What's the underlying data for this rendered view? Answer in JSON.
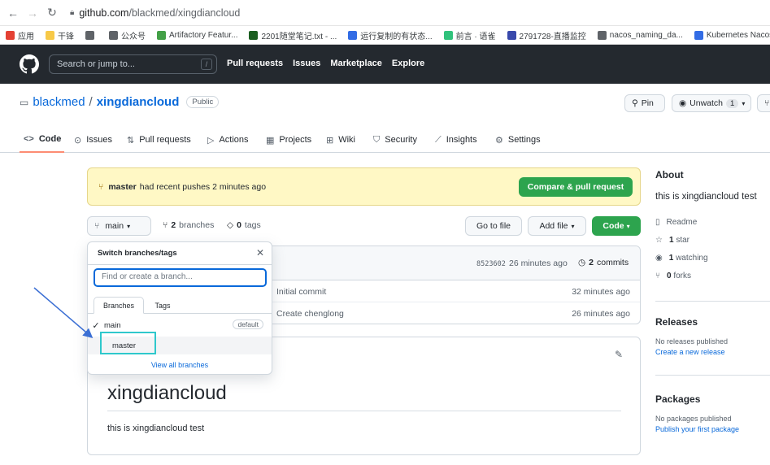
{
  "browser": {
    "url_host": "github.com",
    "url_path": "/blackmed/xingdiancloud",
    "bookmarks": [
      {
        "label": "应用",
        "color": "#e44134"
      },
      {
        "label": "干锋",
        "color": "#f7c948"
      },
      {
        "label": "",
        "color": "#5f6368"
      },
      {
        "label": "公众号",
        "color": "#5f6368"
      },
      {
        "label": "Artifactory Featur...",
        "color": "#43a047"
      },
      {
        "label": "2201随堂笔记.txt - ...",
        "color": "#1b5e20"
      },
      {
        "label": "运行复制的有状态...",
        "color": "#326ce5"
      },
      {
        "label": "前言 · 语雀",
        "color": "#31c27c"
      },
      {
        "label": "2791728-直播监控",
        "color": "#3949ab"
      },
      {
        "label": "nacos_naming_da...",
        "color": "#5f6368"
      },
      {
        "label": "Kubernetes Nacos",
        "color": "#326ce5"
      }
    ]
  },
  "header": {
    "search_placeholder": "Search or jump to...",
    "search_key": "/",
    "nav": [
      "Pull requests",
      "Issues",
      "Marketplace",
      "Explore"
    ]
  },
  "repo": {
    "owner": "blackmed",
    "separator": "/",
    "name": "xingdiancloud",
    "visibility": "Public",
    "pin_label": "Pin",
    "watch_label": "Unwatch",
    "watch_count": "1"
  },
  "tabs": [
    {
      "label": "Code",
      "icon": "<>"
    },
    {
      "label": "Issues",
      "icon": "⊙"
    },
    {
      "label": "Pull requests",
      "icon": "⇅"
    },
    {
      "label": "Actions",
      "icon": "▷"
    },
    {
      "label": "Projects",
      "icon": "▦"
    },
    {
      "label": "Wiki",
      "icon": "⊞"
    },
    {
      "label": "Security",
      "icon": "⛉"
    },
    {
      "label": "Insights",
      "icon": "⟋"
    },
    {
      "label": "Settings",
      "icon": "⚙"
    }
  ],
  "notice": {
    "branch": "master",
    "text": "had recent pushes 2 minutes ago",
    "button": "Compare & pull request"
  },
  "branch_bar": {
    "current": "main",
    "branches_count": "2",
    "branches_label": "branches",
    "tags_count": "0",
    "tags_label": "tags",
    "goto_file": "Go to file",
    "add_file": "Add file",
    "code": "Code"
  },
  "files": {
    "sha": "8523602",
    "last_commit_time": "26 minutes ago",
    "commits_count": "2",
    "commits_label": "commits",
    "rows": [
      {
        "message": "Initial commit",
        "time": "32 minutes ago"
      },
      {
        "message": "Create chenglong",
        "time": "26 minutes ago"
      }
    ]
  },
  "readme": {
    "heading": "xingdiancloud",
    "body": "this is xingdiancloud test"
  },
  "sidebar": {
    "about_title": "About",
    "description": "this is xingdiancloud test",
    "readme": "Readme",
    "stars_count": "1",
    "stars_label": "star",
    "watching_count": "1",
    "watching_label": "watching",
    "forks_count": "0",
    "forks_label": "forks",
    "releases_title": "Releases",
    "releases_none": "No releases published",
    "releases_link": "Create a new release",
    "packages_title": "Packages",
    "packages_none": "No packages published",
    "packages_link": "Publish your first package"
  },
  "dropdown": {
    "title": "Switch branches/tags",
    "input_placeholder": "Find or create a branch...",
    "tab_branches": "Branches",
    "tab_tags": "Tags",
    "items": [
      {
        "name": "main",
        "checked": true,
        "badge": "default"
      },
      {
        "name": "master",
        "checked": false,
        "badge": ""
      }
    ],
    "view_all": "View all branches"
  },
  "annotation": {
    "highlight_color": "#2fc8cc",
    "arrow_color": "#3b6fd4"
  }
}
